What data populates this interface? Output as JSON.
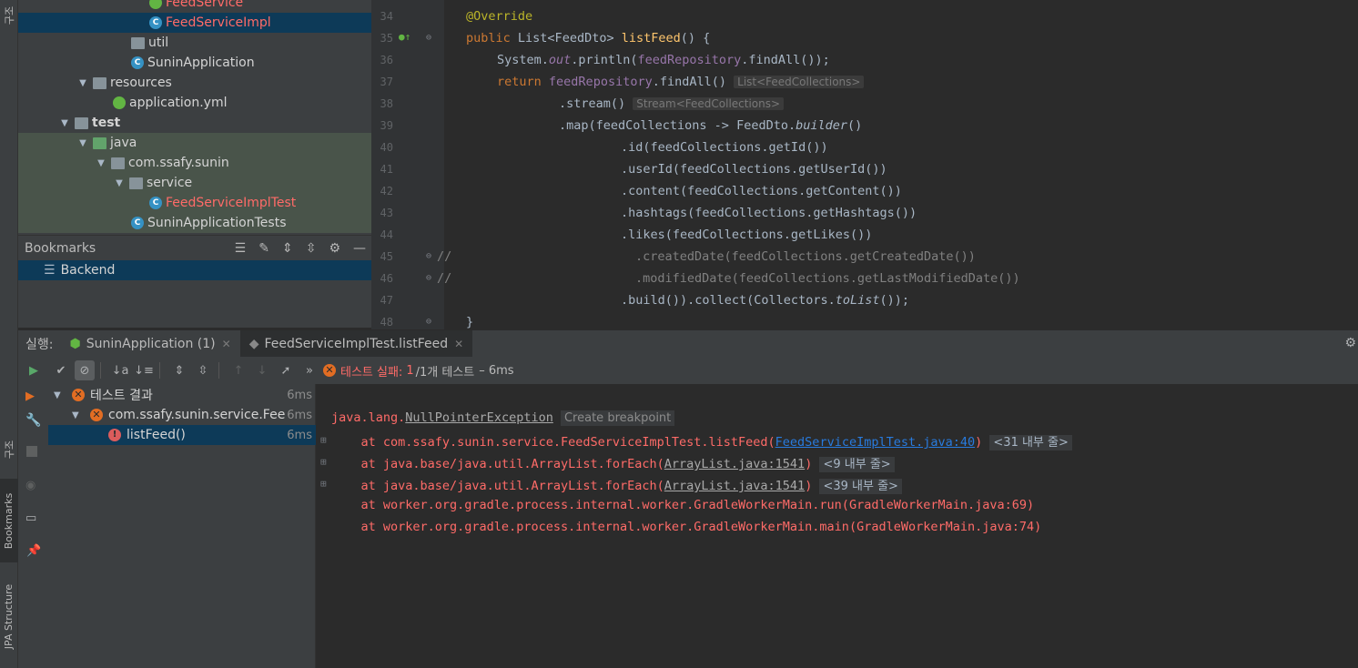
{
  "left_strip": {
    "structure_label": "구조",
    "bookmarks_label": "Bookmarks",
    "jpa_label": "JPA Structure"
  },
  "project_tree": {
    "rows": [
      {
        "label": "FeedService"
      },
      {
        "label": "FeedServiceImpl"
      },
      {
        "label": "util"
      },
      {
        "label": "SuninApplication"
      },
      {
        "label": "resources"
      },
      {
        "label": "application.yml"
      },
      {
        "label": "test"
      },
      {
        "label": "java"
      },
      {
        "label": "com.ssafy.sunin"
      },
      {
        "label": "service"
      },
      {
        "label": "FeedServiceImplTest"
      },
      {
        "label": "SuninApplicationTests"
      }
    ]
  },
  "bookmarks": {
    "title": "Bookmarks",
    "items": [
      {
        "label": "Backend"
      }
    ]
  },
  "editor": {
    "line_numbers": [
      "34",
      "35",
      "36",
      "37",
      "38",
      "39",
      "40",
      "41",
      "42",
      "43",
      "44",
      "45",
      "46",
      "47",
      "48"
    ],
    "l34": {
      "annotation": "@Override"
    },
    "l35": {
      "kw": "public",
      "type": "List<FeedDto>",
      "method": "listFeed",
      "rest": "() {"
    },
    "l36": {
      "a": "System.",
      "field": "out",
      "b": ".println(",
      "repo": "feedRepository",
      "c": ".findAll());"
    },
    "l37": {
      "kw": "return",
      "repo": "feedRepository",
      "c": ".findAll()",
      "hint": "List<FeedCollections>"
    },
    "l38": {
      "code": ".stream()",
      "hint": "Stream<FeedCollections>"
    },
    "l39": {
      "a": ".map(feedCollections -> FeedDto.",
      "builder": "builder",
      "b": "()"
    },
    "l40": {
      "code": ".id(feedCollections.getId())"
    },
    "l41": {
      "code": ".userId(feedCollections.getUserId())"
    },
    "l42": {
      "code": ".content(feedCollections.getContent())"
    },
    "l43": {
      "code": ".hashtags(feedCollections.getHashtags())"
    },
    "l44": {
      "code": ".likes(feedCollections.getLikes())"
    },
    "l45": {
      "prefix": "//",
      "code": ".createdDate(feedCollections.getCreatedDate())"
    },
    "l46": {
      "prefix": "//",
      "code": ".modifiedDate(feedCollections.getLastModifiedDate())"
    },
    "l47": {
      "a": ".build()).collect(Collectors.",
      "toList": "toList",
      "b": "());"
    },
    "l48": {
      "code": "}"
    }
  },
  "run": {
    "label": "실행:",
    "tabs": [
      {
        "label": "SuninApplication (1)"
      },
      {
        "label": "FeedServiceImplTest.listFeed"
      }
    ],
    "status": {
      "fail_label": "테스트 실패:",
      "count": "1",
      "total": "/1개 테스트",
      "time": "– 6ms"
    }
  },
  "test_tree": {
    "rows": [
      {
        "label": "테스트 결과",
        "time": "6ms"
      },
      {
        "label": "com.ssafy.sunin.service.FeedServiceImplTest",
        "time": "6ms"
      },
      {
        "label": "listFeed()",
        "time": "6ms"
      }
    ]
  },
  "console": {
    "exception": "java.lang.",
    "exception_name": "NullPointerException",
    "create_bp": "Create breakpoint",
    "lines": [
      {
        "prefix": "    at com.ssafy.sunin.service.FeedServiceImplTest.listFeed(",
        "link": "FeedServiceImplTest.java:40",
        "suffix": ")",
        "box": "<31 내부 줄>"
      },
      {
        "prefix": "    at java.base/java.util.ArrayList.forEach(",
        "link": "ArrayList.java:1541",
        "suffix": ")",
        "box": "<9 내부 줄>"
      },
      {
        "prefix": "    at java.base/java.util.ArrayList.forEach(",
        "link": "ArrayList.java:1541",
        "suffix": ")",
        "box": "<39 내부 줄>"
      },
      {
        "text": "    at worker.org.gradle.process.internal.worker.GradleWorkerMain.run(GradleWorkerMain.java:69)"
      },
      {
        "text": "    at worker.org.gradle.process.internal.worker.GradleWorkerMain.main(GradleWorkerMain.java:74)"
      }
    ]
  }
}
